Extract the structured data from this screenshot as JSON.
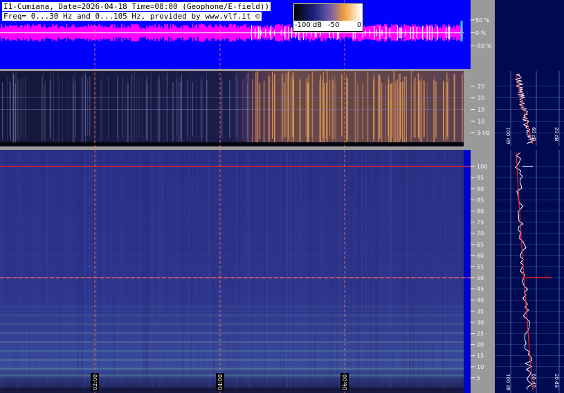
{
  "header": {
    "line1": "I1-Cumiana, Date=2026-04-18 Time=08:00 (Geophone/E-field))",
    "line2": "Freq= 0...30 Hz and 0...105 Hz, provided by www.vlf.it ©"
  },
  "colorbar": {
    "labels": [
      "-100 dB",
      "-50",
      "0"
    ]
  },
  "colors": {
    "background": "#0000ff",
    "waveform": "#ff00ff",
    "spectrogram_low": "#1a1f6b",
    "spectrogram_high": "#f0a040",
    "marker_line": "#ff2020",
    "grid": "#6fa8ff",
    "side_panel": "#000a50"
  },
  "chart_data": [
    {
      "type": "line",
      "panel": "waveform",
      "ytick_labels": [
        "50 %",
        "0 %",
        "-50 %"
      ],
      "yticks": [
        50,
        0,
        -50
      ],
      "ylim": [
        -100,
        100
      ]
    },
    {
      "type": "heatmap",
      "panel": "spectrogram-low",
      "ylim": [
        0,
        30
      ],
      "yticks": [
        25,
        20,
        15,
        10,
        5
      ],
      "ytick_labels": [
        "25",
        "20",
        "15",
        "10",
        "5 Hz"
      ]
    },
    {
      "type": "heatmap",
      "panel": "spectrogram-high",
      "ylim": [
        0,
        105
      ],
      "yticks": [
        100,
        95,
        90,
        85,
        80,
        75,
        70,
        65,
        60,
        55,
        50,
        45,
        40,
        35,
        30,
        25,
        20,
        15,
        10,
        5
      ],
      "ytick_labels": [
        "100",
        "95",
        "90",
        "85",
        "80",
        "75",
        "70",
        "65",
        "60",
        "55",
        "50",
        "45",
        "40",
        "35",
        "30",
        "25",
        "20",
        "15",
        "10",
        "5"
      ],
      "x_time_labels": [
        "02:00",
        "04:00",
        "06:00"
      ],
      "marker_lines_hz": [
        100,
        50
      ]
    },
    {
      "type": "line",
      "panel": "spectrum-side-low",
      "xtick_labels": [
        "100 dB",
        "60 dB",
        "20 dB"
      ]
    },
    {
      "type": "line",
      "panel": "spectrum-side-high",
      "xtick_labels": [
        "100 dB",
        "60 dB",
        "20 dB"
      ]
    }
  ]
}
